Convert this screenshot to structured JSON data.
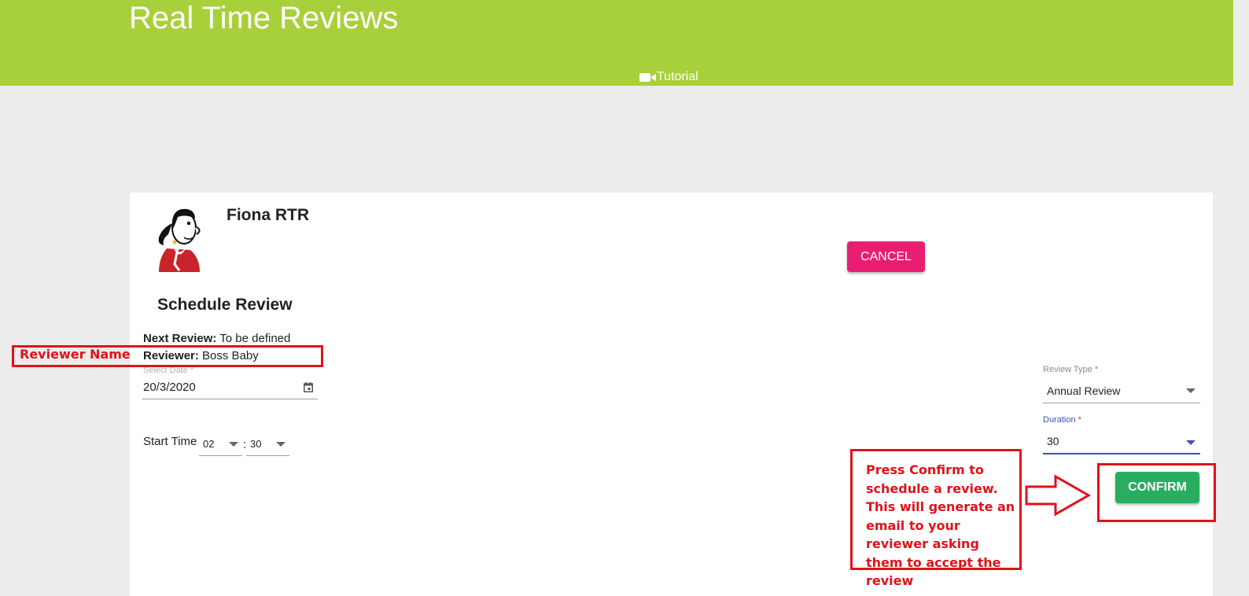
{
  "header": {
    "title": "Real Time Reviews",
    "tutorial_label": "Tutorial",
    "tutorial_icon": "video-camera-icon"
  },
  "profile": {
    "name": "Fiona RTR",
    "avatar": "cartoon-avatar"
  },
  "actions": {
    "cancel_label": "CANCEL",
    "confirm_label": "CONFIRM"
  },
  "schedule": {
    "title": "Schedule Review",
    "next_review_label": "Next Review:",
    "next_review_value": "To be defined",
    "reviewer_label": "Reviewer:",
    "reviewer_value": "Boss Baby",
    "date_label": "Select Date *",
    "date_value": "20/3/2020",
    "start_time_label": "Start Time",
    "hour_value": "02",
    "time_separator": ":",
    "minute_value": "30"
  },
  "review_type": {
    "label": "Review Type *",
    "value": "Annual Review"
  },
  "duration": {
    "label": "Duration",
    "required_mark": "*",
    "value": "30"
  },
  "annotations": {
    "reviewer_name": "Reviewer Name",
    "confirm_note": "Press Confirm to schedule a review. This will generate an email to your reviewer asking them to accept the review"
  },
  "colors": {
    "header_bg": "#a8d03a",
    "cancel_bg": "#e91e73",
    "confirm_bg": "#27ae60",
    "annotation": "#e0121b",
    "focus": "#3f51b5"
  }
}
